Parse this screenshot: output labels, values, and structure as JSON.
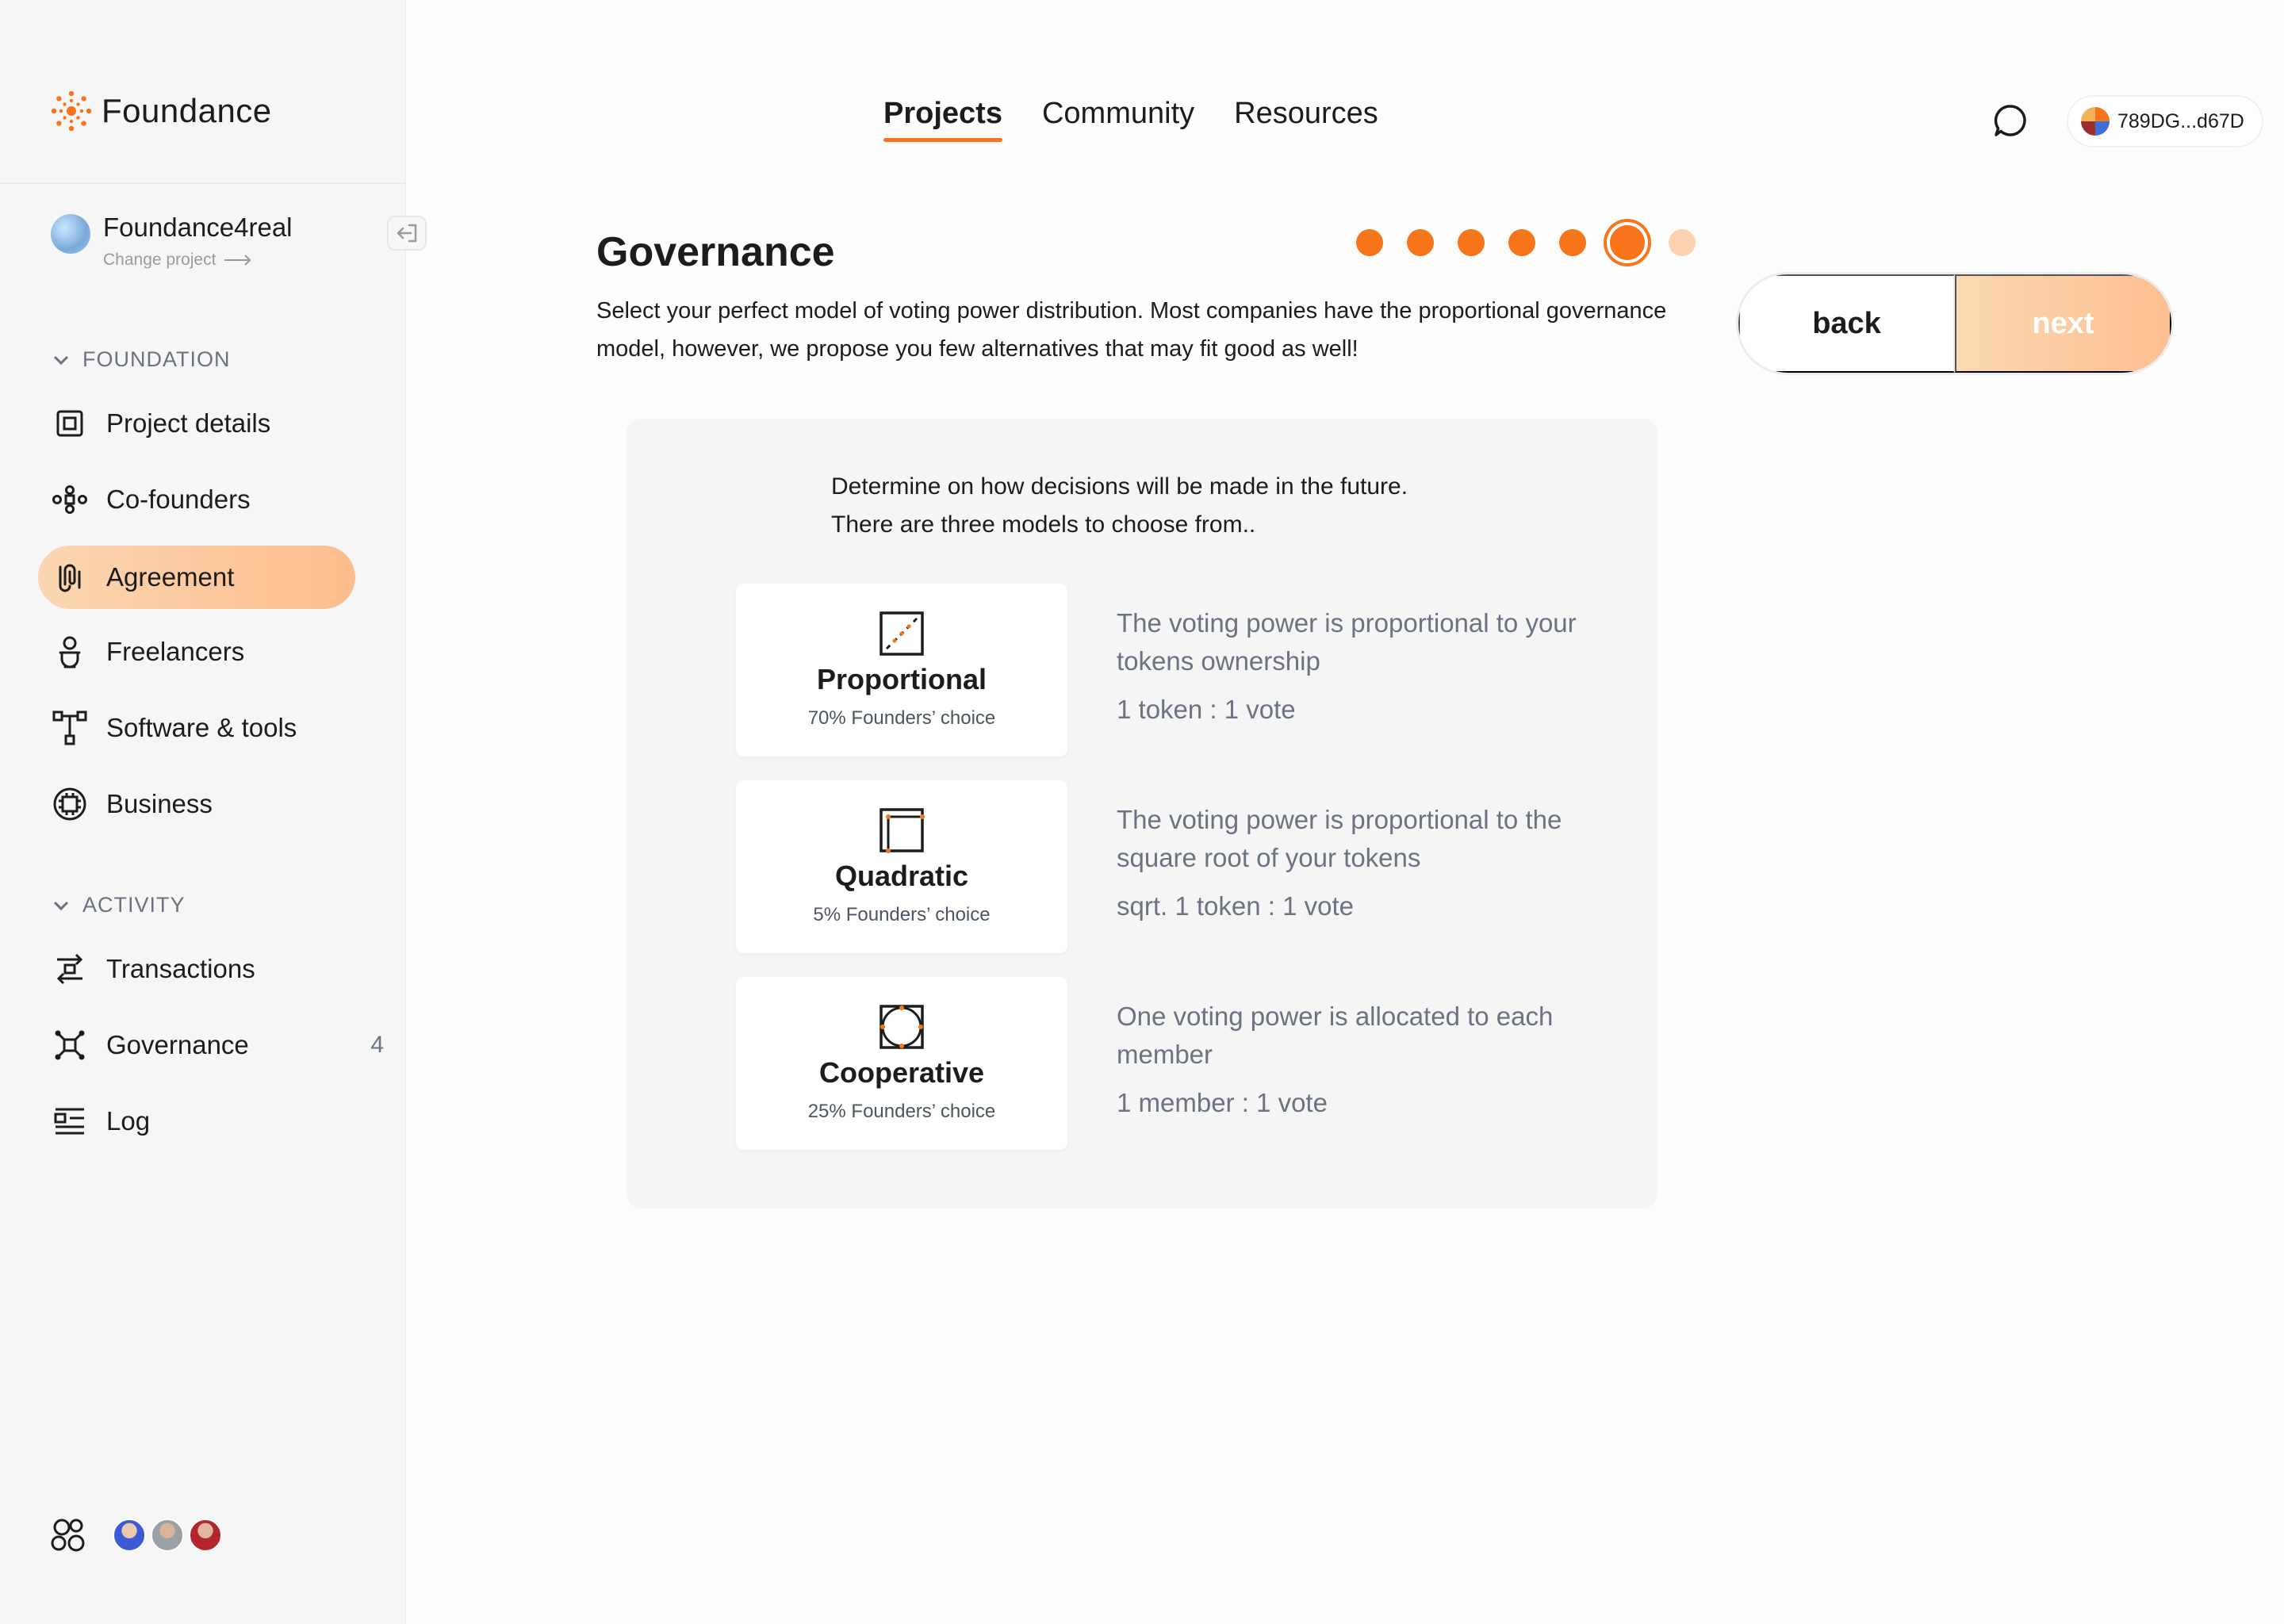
{
  "app": {
    "name": "Foundance"
  },
  "project": {
    "name": "Foundance4real",
    "change_label": "Change project"
  },
  "sidebar": {
    "foundation_label": "FOUNDATION",
    "activity_label": "ACTIVITY",
    "foundation_items": [
      {
        "label": "Project details",
        "icon": "project-details-icon"
      },
      {
        "label": "Co-founders",
        "icon": "co-founders-icon"
      },
      {
        "label": "Agreement",
        "icon": "agreement-icon",
        "active": true
      },
      {
        "label": "Freelancers",
        "icon": "freelancers-icon"
      },
      {
        "label": "Software & tools",
        "icon": "software-tools-icon"
      },
      {
        "label": "Business",
        "icon": "business-icon"
      }
    ],
    "activity_items": [
      {
        "label": "Transactions",
        "icon": "transactions-icon"
      },
      {
        "label": "Governance",
        "icon": "governance-icon",
        "badge": "4"
      },
      {
        "label": "Log",
        "icon": "log-icon"
      }
    ]
  },
  "topnav": {
    "links": [
      {
        "label": "Projects",
        "active": true
      },
      {
        "label": "Community"
      },
      {
        "label": "Resources"
      }
    ]
  },
  "wallet": {
    "address": "789DG...d67D"
  },
  "page": {
    "title": "Governance",
    "intro": " Select your perfect model of voting power distribution. Most companies have the proportional governance model, however, we propose you few alternatives that may fit good as well!",
    "steps": {
      "total": 7,
      "current": 6
    }
  },
  "buttons": {
    "back": "back",
    "next": "next"
  },
  "panel": {
    "lead": "Determine on how decisions will be made in the future. There are three models to choose from..",
    "options": [
      {
        "title": "Proportional",
        "subtitle": "70% Founders’ choice",
        "description": "The voting power is proportional to your tokens ownership",
        "ratio": "1 token : 1 vote",
        "icon": "proportional-icon"
      },
      {
        "title": "Quadratic",
        "subtitle": "5% Founders’ choice",
        "description": "The voting power is proportional to the square root of your tokens",
        "ratio": "sqrt. 1 token : 1 vote",
        "icon": "quadratic-icon"
      },
      {
        "title": "Cooperative",
        "subtitle": "25% Founders’ choice",
        "description": "One voting power is allocated to each member",
        "ratio": "1 member : 1 vote",
        "icon": "cooperative-icon"
      }
    ]
  },
  "colors": {
    "accent": "#f7741a",
    "accent_light": "#fdbd8c",
    "pending_step": "#fcd2b0"
  }
}
